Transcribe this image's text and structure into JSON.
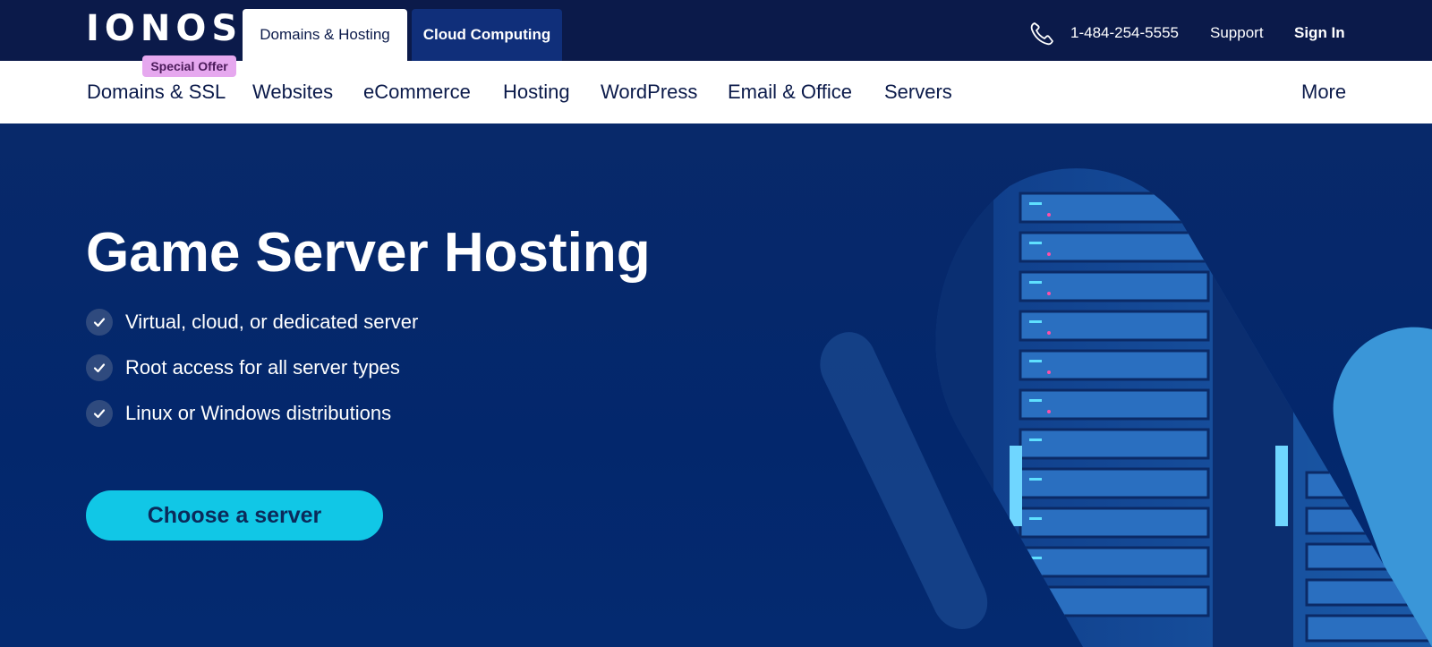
{
  "header": {
    "logo": "IONOS",
    "tabs": [
      {
        "label": "Domains & Hosting",
        "active": true
      },
      {
        "label": "Cloud Computing",
        "active": false
      }
    ],
    "phone": "1-484-254-5555",
    "support": "Support",
    "sign_in": "Sign In"
  },
  "nav": {
    "badge": "Special Offer",
    "items": [
      {
        "label": "Domains & SSL"
      },
      {
        "label": "Websites"
      },
      {
        "label": "eCommerce"
      },
      {
        "label": "Hosting"
      },
      {
        "label": "WordPress"
      },
      {
        "label": "Email & Office"
      },
      {
        "label": "Servers"
      },
      {
        "label": "More"
      }
    ]
  },
  "hero": {
    "title": "Game Server Hosting",
    "features": [
      {
        "text": "Virtual, cloud, or dedicated server"
      },
      {
        "text": "Root access for all server types"
      },
      {
        "text": "Linux or Windows distributions"
      }
    ],
    "cta_label": "Choose a server",
    "image_icon": "server-rack-image"
  },
  "colors": {
    "topbar": "#0b1a4a",
    "hero_bg": "#03276c",
    "cta": "#11c7e6",
    "badge": "#e6a8ef"
  }
}
